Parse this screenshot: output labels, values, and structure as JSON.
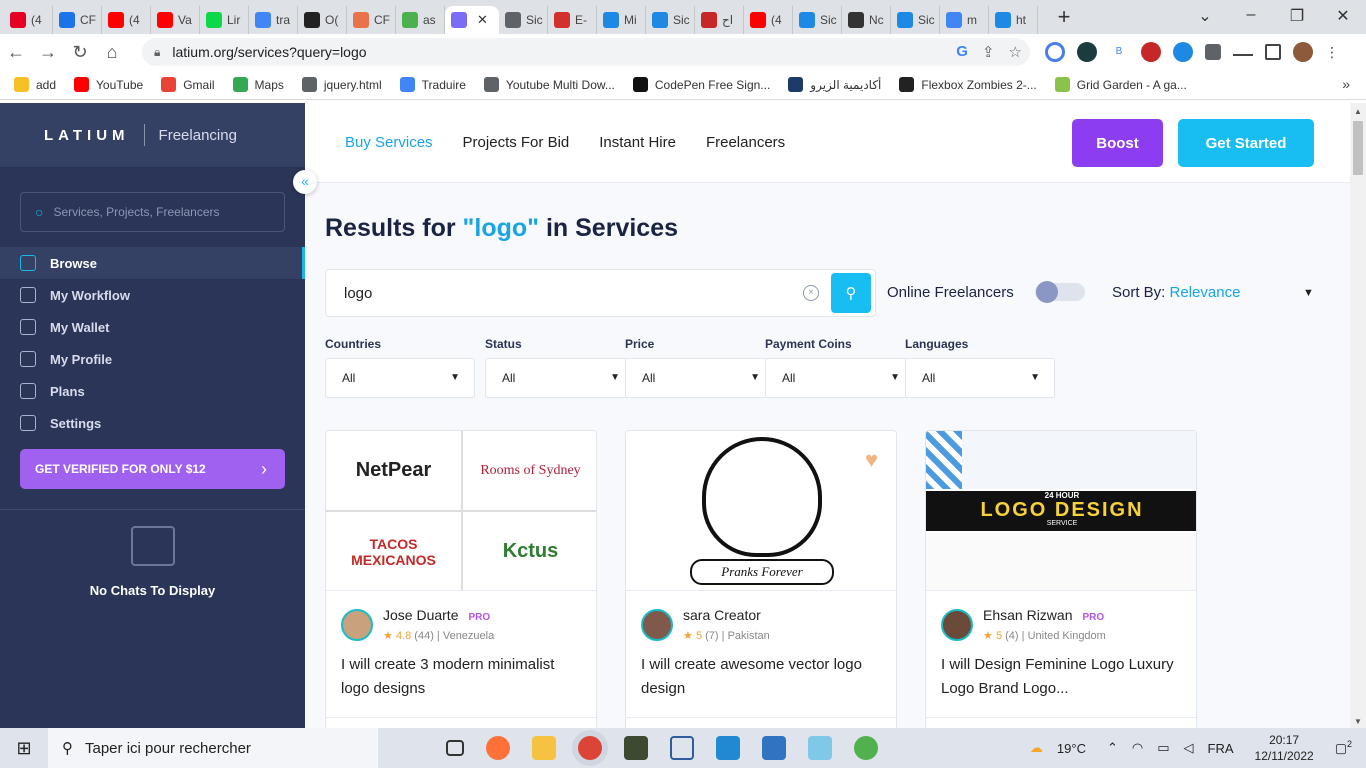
{
  "browser": {
    "tabs": [
      {
        "label": "(4",
        "color": "#e60023"
      },
      {
        "label": "CF",
        "color": "#1a73e8"
      },
      {
        "label": "(4",
        "color": "#ff0000"
      },
      {
        "label": "Va",
        "color": "#ff0000"
      },
      {
        "label": "Lir",
        "color": "#0cd84a"
      },
      {
        "label": "tra",
        "color": "#4285f4"
      },
      {
        "label": "O(",
        "color": "#222222"
      },
      {
        "label": "CF",
        "color": "#e8734a"
      },
      {
        "label": "as",
        "color": "#4caf50"
      },
      {
        "label": "",
        "color": "#7b6cf6",
        "active": true
      },
      {
        "label": "Sic",
        "color": "#5f6368"
      },
      {
        "label": "E-",
        "color": "#d32f2f"
      },
      {
        "label": "Mi",
        "color": "#1e88e5"
      },
      {
        "label": "Sic",
        "color": "#1e88e5"
      },
      {
        "label": "اح",
        "color": "#c62828"
      },
      {
        "label": "(4",
        "color": "#ff0000"
      },
      {
        "label": "Sic",
        "color": "#1e88e5"
      },
      {
        "label": "Nc",
        "color": "#333333"
      },
      {
        "label": "Sic",
        "color": "#1e88e5"
      },
      {
        "label": "m",
        "color": "#4285f4"
      },
      {
        "label": "ht",
        "color": "#1e88e5"
      }
    ],
    "url": "latium.org/services?query=logo",
    "bookmarks": [
      {
        "label": "add",
        "color": "#f6c026"
      },
      {
        "label": "YouTube",
        "color": "#ff0000"
      },
      {
        "label": "Gmail",
        "color": "#ea4335"
      },
      {
        "label": "Maps",
        "color": "#34a853"
      },
      {
        "label": "jquery.html",
        "color": "#5f6368"
      },
      {
        "label": "Traduire",
        "color": "#4285f4"
      },
      {
        "label": "Youtube Multi Dow...",
        "color": "#5f6368"
      },
      {
        "label": "CodePen Free Sign...",
        "color": "#111111"
      },
      {
        "label": "أكاديمية الزيرو",
        "color": "#1e3a6b"
      },
      {
        "label": "Flexbox Zombies 2-...",
        "color": "#222222"
      },
      {
        "label": "Grid Garden - A ga...",
        "color": "#8bc34a"
      }
    ]
  },
  "sidebar": {
    "brand": "LATIUM",
    "brand_sub": "Freelancing",
    "search_placeholder": "Services, Projects, Freelancers",
    "menu": [
      {
        "label": "Browse",
        "icon": "grid-icon",
        "active": true
      },
      {
        "label": "My Workflow",
        "icon": "folder-icon"
      },
      {
        "label": "My Wallet",
        "icon": "wallet-icon"
      },
      {
        "label": "My Profile",
        "icon": "folder-user-icon"
      },
      {
        "label": "Plans",
        "icon": "plans-icon"
      },
      {
        "label": "Settings",
        "icon": "gear-icon"
      }
    ],
    "verify_label": "GET VERIFIED FOR ONLY $12",
    "no_chats": "No Chats To Display"
  },
  "nav": {
    "links": [
      "Buy Services",
      "Projects For Bid",
      "Instant Hire",
      "Freelancers"
    ],
    "active": "Buy Services",
    "boost": "Boost",
    "get_started": "Get Started"
  },
  "results": {
    "prefix": "Results for",
    "query": "\"logo\"",
    "suffix": "in Services",
    "search_value": "logo",
    "online_label": "Online Freelancers",
    "sort_label": "Sort By:",
    "sort_value": "Relevance"
  },
  "filters": [
    {
      "label": "Countries",
      "value": "All"
    },
    {
      "label": "Status",
      "value": "All"
    },
    {
      "label": "Price",
      "value": "All"
    },
    {
      "label": "Payment Coins",
      "value": "All"
    },
    {
      "label": "Languages",
      "value": "All"
    }
  ],
  "cards": [
    {
      "name": "Jose Duarte",
      "pro": "PRO",
      "rating": "4.8",
      "reviews": "(44)",
      "country": "Venezuela",
      "title": "I will create 3 modern minimalist logo designs",
      "img_text": [
        "NetPear",
        "Rooms of Sydney",
        "TACOS MEXICANOS",
        "Kctus"
      ]
    },
    {
      "name": "sara Creator",
      "pro": "",
      "rating": "5",
      "reviews": "(7)",
      "country": "Pakistan",
      "title": "I will create awesome vector logo design",
      "img_text": [
        "Pranks Forever"
      ]
    },
    {
      "name": "Ehsan Rizwan",
      "pro": "PRO",
      "rating": "5",
      "reviews": "(4)",
      "country": "United Kingdom",
      "title": "I will Design Feminine Logo Luxury Logo Brand Logo...",
      "img_text": [
        "24 HOUR",
        "LOGO DESIGN",
        "SERVICE"
      ]
    }
  ],
  "taskbar": {
    "search_placeholder": "Taper ici pour rechercher",
    "weather": "19°C",
    "lang": "FRA",
    "time": "20:17",
    "date": "12/11/2022",
    "notif": "2"
  }
}
